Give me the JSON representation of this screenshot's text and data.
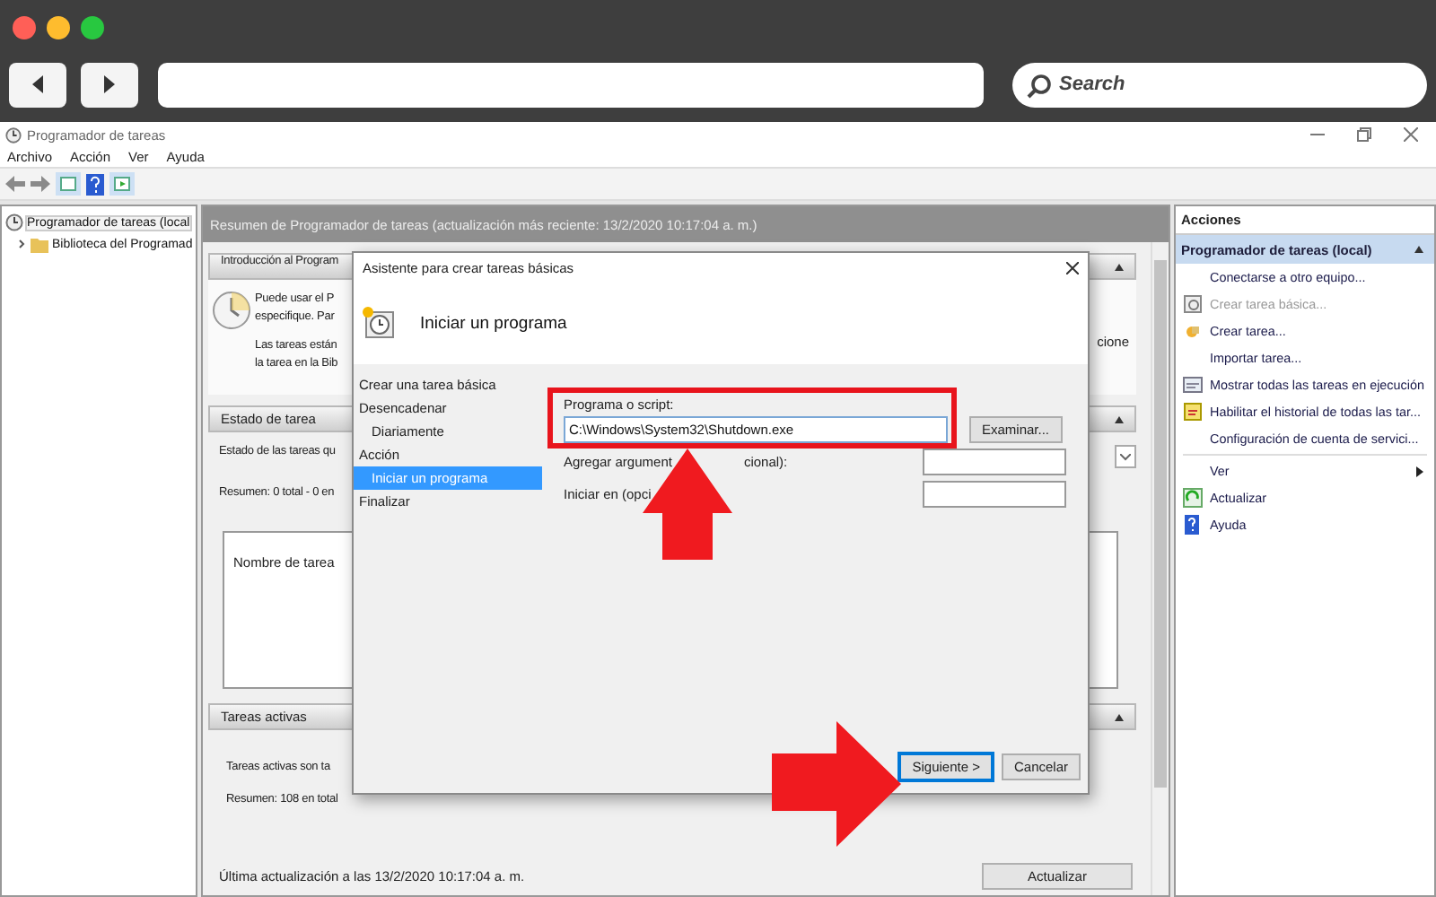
{
  "browser": {
    "search": {
      "placeholder": "Search"
    }
  },
  "window": {
    "title": "Programador de tareas"
  },
  "menu": [
    "Archivo",
    "Acción",
    "Ver",
    "Ayuda"
  ],
  "tree": [
    {
      "label": "Programador de tareas (local",
      "selected": true,
      "children": [
        {
          "label": "Biblioteca del Programad",
          "selected": false,
          "expanded": false
        }
      ]
    }
  ],
  "summary": {
    "header": "Resumen de Programador de tareas (actualización más reciente: 13/2/2020 10:17:04 a. m.)",
    "intro": {
      "title": "Introducción al Program",
      "expanded": true,
      "lines": [
        "Puede usar el P",
        "especifique. Par"
      ],
      "more_lines": [
        "Las tareas están",
        "la tarea en la Bib"
      ],
      "tail": "cione"
    },
    "status": {
      "title": "Estado de tarea",
      "expanded": true,
      "text": "Estado de las tareas qu",
      "summary": "Resumen: 0 total - 0 en",
      "column": "Nombre de tarea"
    },
    "active": {
      "title": "Tareas activas",
      "expanded": true,
      "text": "Tareas activas son ta",
      "summary": "Resumen: 108 en total"
    },
    "updated": "Última actualización a las 13/2/2020 10:17:04 a. m.",
    "refresh": "Actualizar"
  },
  "dialog": {
    "title": "Asistente para crear tareas básicas",
    "heading": "Iniciar un programa",
    "steps": [
      {
        "label": "Crear una tarea básica",
        "selected": false
      },
      {
        "label": "Desencadenar",
        "selected": false,
        "children": [
          {
            "label": "Diariamente",
            "selected": false
          }
        ]
      },
      {
        "label": "Acción",
        "selected": false,
        "children": [
          {
            "label": "Iniciar un programa",
            "selected": true
          }
        ]
      },
      {
        "label": "Finalizar",
        "selected": false
      }
    ],
    "program_label": "Programa o script:",
    "program_value": "C:\\Windows\\System32\\Shutdown.exe",
    "browse": "Examinar...",
    "arguments_label": [
      "Agregar argument",
      "cional):"
    ],
    "start_label": "Iniciar en (opci",
    "buttons": [
      {
        "label": "Siguiente >",
        "default": true
      },
      {
        "label": "Cancelar",
        "default": false
      }
    ]
  },
  "actions": {
    "title": "Acciones",
    "group": "Programador de tareas (local)",
    "items": [
      {
        "label": "Conectarse a otro equipo...",
        "kind": "item",
        "disabled": false
      },
      {
        "label": "Crear tarea básica...",
        "kind": "item",
        "disabled": true
      },
      {
        "label": "Crear tarea...",
        "kind": "item",
        "disabled": false
      },
      {
        "label": "Importar tarea...",
        "kind": "item",
        "disabled": false
      },
      {
        "label": "Mostrar todas las tareas en ejecución",
        "kind": "item",
        "disabled": false
      },
      {
        "label": "Habilitar el historial de todas las tar...",
        "kind": "item",
        "disabled": false
      },
      {
        "label": "Configuración de cuenta de servici...",
        "kind": "item",
        "disabled": false
      },
      {
        "label": "Ver",
        "kind": "submenu",
        "disabled": false
      },
      {
        "label": "Actualizar",
        "kind": "item",
        "disabled": false
      },
      {
        "label": "Ayuda",
        "kind": "item",
        "disabled": false
      }
    ]
  }
}
